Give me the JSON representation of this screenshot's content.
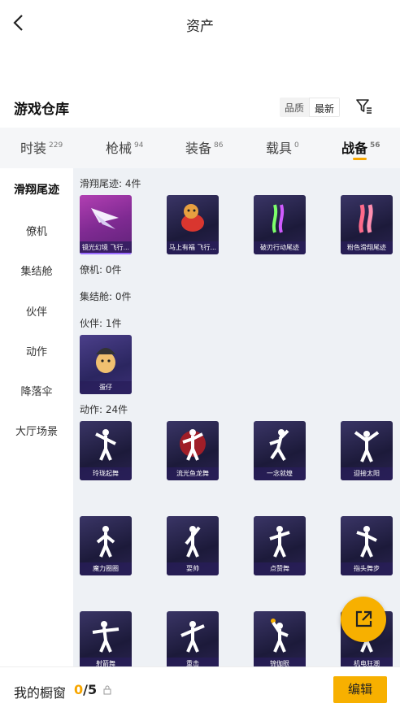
{
  "header": {
    "title": "资产"
  },
  "warehouse": {
    "title": "游戏仓库",
    "sort_options": [
      "品质",
      "最新"
    ]
  },
  "tabs": [
    {
      "label": "时装",
      "count": "229"
    },
    {
      "label": "枪械",
      "count": "94"
    },
    {
      "label": "装备",
      "count": "86"
    },
    {
      "label": "载具",
      "count": "0"
    },
    {
      "label": "战备",
      "count": "56"
    }
  ],
  "sidebar": {
    "items": [
      "滑翔尾迹",
      "僚机",
      "集结舱",
      "伙伴",
      "动作",
      "降落伞",
      "大厅场景"
    ]
  },
  "groups": {
    "trail": {
      "label": "滑翔尾迹: 4件",
      "items": [
        "镜光幻境 飞行...",
        "马上有福 飞行...",
        "破刃行动尾迹",
        "粉色滑翔尾迹"
      ]
    },
    "wingman": {
      "label": "僚机: 0件"
    },
    "capsule": {
      "label": "集结舱: 0件"
    },
    "partner": {
      "label": "伙伴: 1件",
      "items": [
        "蛋仔"
      ]
    },
    "emote": {
      "label": "动作: 24件",
      "items": [
        "玲珑起舞",
        "流光鱼龙舞",
        "一念就煌",
        "迎接太阳",
        "魔力圈圈",
        "耍帅",
        "点赞舞",
        "指头舞步",
        "射箭舞",
        "重击",
        "锦伽眼",
        "机电狂潮"
      ]
    }
  },
  "showcase": {
    "label": "我的橱窗",
    "used": "0",
    "total": "/5"
  },
  "edit_label": "编辑",
  "colors": {
    "accent": "#f7b000",
    "card_bg": "#2b2660"
  },
  "icons": [
    "chevron-left-icon",
    "filter-icon",
    "lock-icon",
    "external-share-icon"
  ]
}
